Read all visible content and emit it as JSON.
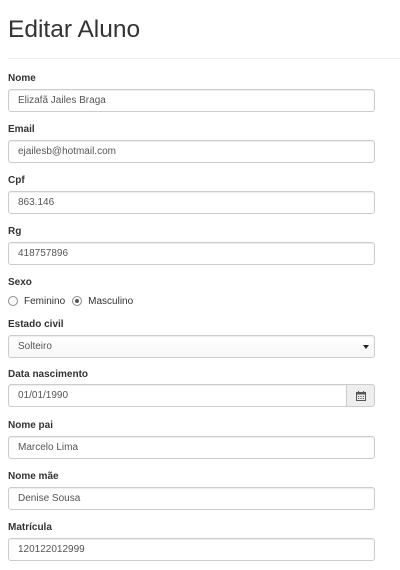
{
  "page": {
    "title": "Editar Aluno"
  },
  "fields": {
    "nome": {
      "label": "Nome",
      "value": "Elizafã Jailes Braga"
    },
    "email": {
      "label": "Email",
      "value": "ejailesb@hotmail.com"
    },
    "cpf": {
      "label": "Cpf",
      "value": "863.146"
    },
    "rg": {
      "label": "Rg",
      "value": "418757896"
    },
    "sexo": {
      "label": "Sexo",
      "options": [
        {
          "label": "Feminino",
          "checked": false
        },
        {
          "label": "Masculino",
          "checked": true
        }
      ]
    },
    "estado_civil": {
      "label": "Estado civil",
      "selected": "Solteiro"
    },
    "data_nascimento": {
      "label": "Data nascimento",
      "value": "01/01/1990",
      "icon": "calendar-icon"
    },
    "nome_pai": {
      "label": "Nome pai",
      "value": "Marcelo Lima"
    },
    "nome_mae": {
      "label": "Nome mãe",
      "value": "Denise Sousa"
    },
    "matricula": {
      "label": "Matrícula",
      "value": "120122012999"
    }
  }
}
